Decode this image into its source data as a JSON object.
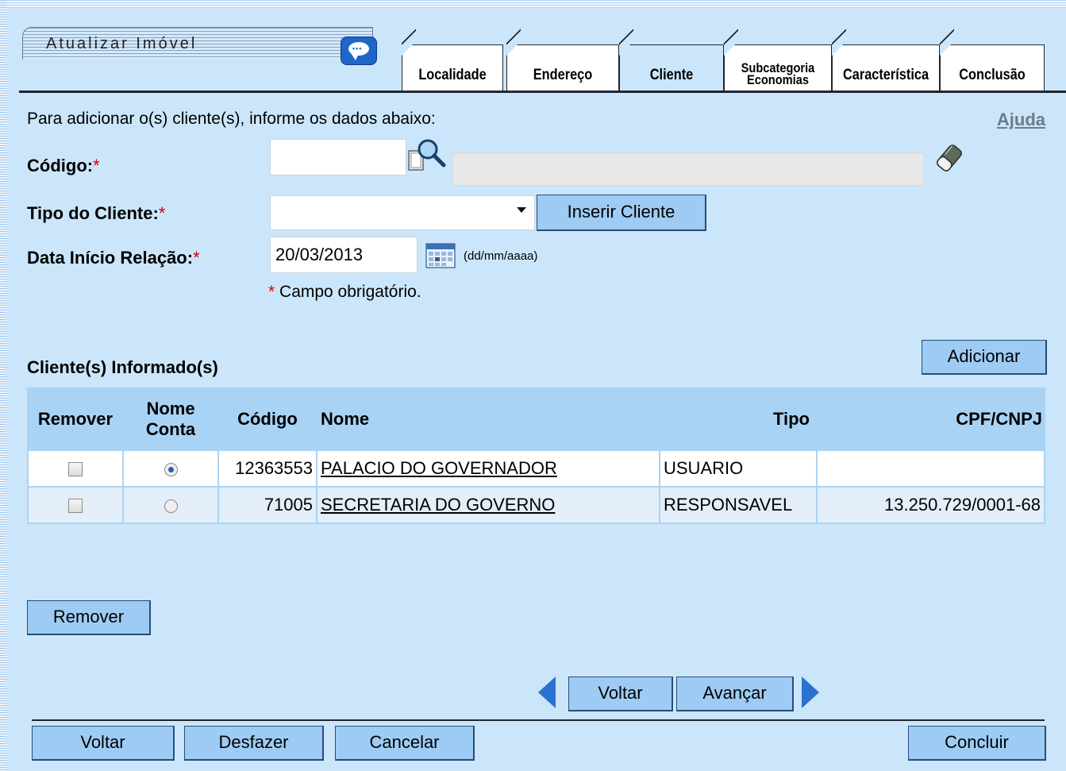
{
  "title": "Atualizar Imóvel",
  "tabs": [
    {
      "label": "Localidade"
    },
    {
      "label": "Endereço"
    },
    {
      "label": "Cliente"
    },
    {
      "label_line1": "Subcategoria",
      "label_line2": "Economias"
    },
    {
      "label": "Característica"
    },
    {
      "label": "Conclusão"
    }
  ],
  "active_tab": "Cliente",
  "intro": "Para adicionar o(s) cliente(s), informe os dados abaixo:",
  "help_label": "Ajuda",
  "form": {
    "codigo_label": "Código:",
    "codigo_value": "",
    "tipo_label": "Tipo do Cliente:",
    "tipo_value": "",
    "inserir_cliente": "Inserir Cliente",
    "data_label": "Data Início Relação:",
    "data_value": "20/03/2013",
    "data_format": "(dd/mm/aaaa)",
    "required_mark": "*",
    "required_note": "Campo obrigatório."
  },
  "clients": {
    "section_title": "Cliente(s) Informado(s)",
    "add_button": "Adicionar",
    "headers": {
      "remover": "Remover",
      "nome_conta_1": "Nome",
      "nome_conta_2": "Conta",
      "codigo": "Código",
      "nome": "Nome",
      "tipo": "Tipo",
      "cpf": "CPF/CNPJ"
    },
    "rows": [
      {
        "codigo": "12363553",
        "nome": "PALACIO DO GOVERNADOR",
        "tipo": "USUARIO",
        "cpf": "",
        "nome_conta_selected": true,
        "remover_checked": false
      },
      {
        "codigo": "71005",
        "nome": "SECRETARIA DO GOVERNO",
        "tipo": "RESPONSAVEL",
        "cpf": "13.250.729/0001-68",
        "nome_conta_selected": false,
        "remover_checked": false
      }
    ],
    "remove_button": "Remover"
  },
  "wizard_nav": {
    "back": "Voltar",
    "next": "Avançar"
  },
  "footer": {
    "voltar": "Voltar",
    "desfazer": "Desfazer",
    "cancelar": "Cancelar",
    "concluir": "Concluir"
  },
  "colors": {
    "page_bg": "#cbe6fa",
    "button_bg": "#9dcbf3",
    "table_header_bg": "#a9d3f5",
    "required": "#d10000",
    "arrow_blue": "#2a72d2"
  },
  "icons": [
    "chat-icon",
    "search-magnifier-icon",
    "eraser-icon",
    "calendar-icon",
    "chevron-down-icon",
    "arrow-left-icon",
    "arrow-right-icon"
  ]
}
